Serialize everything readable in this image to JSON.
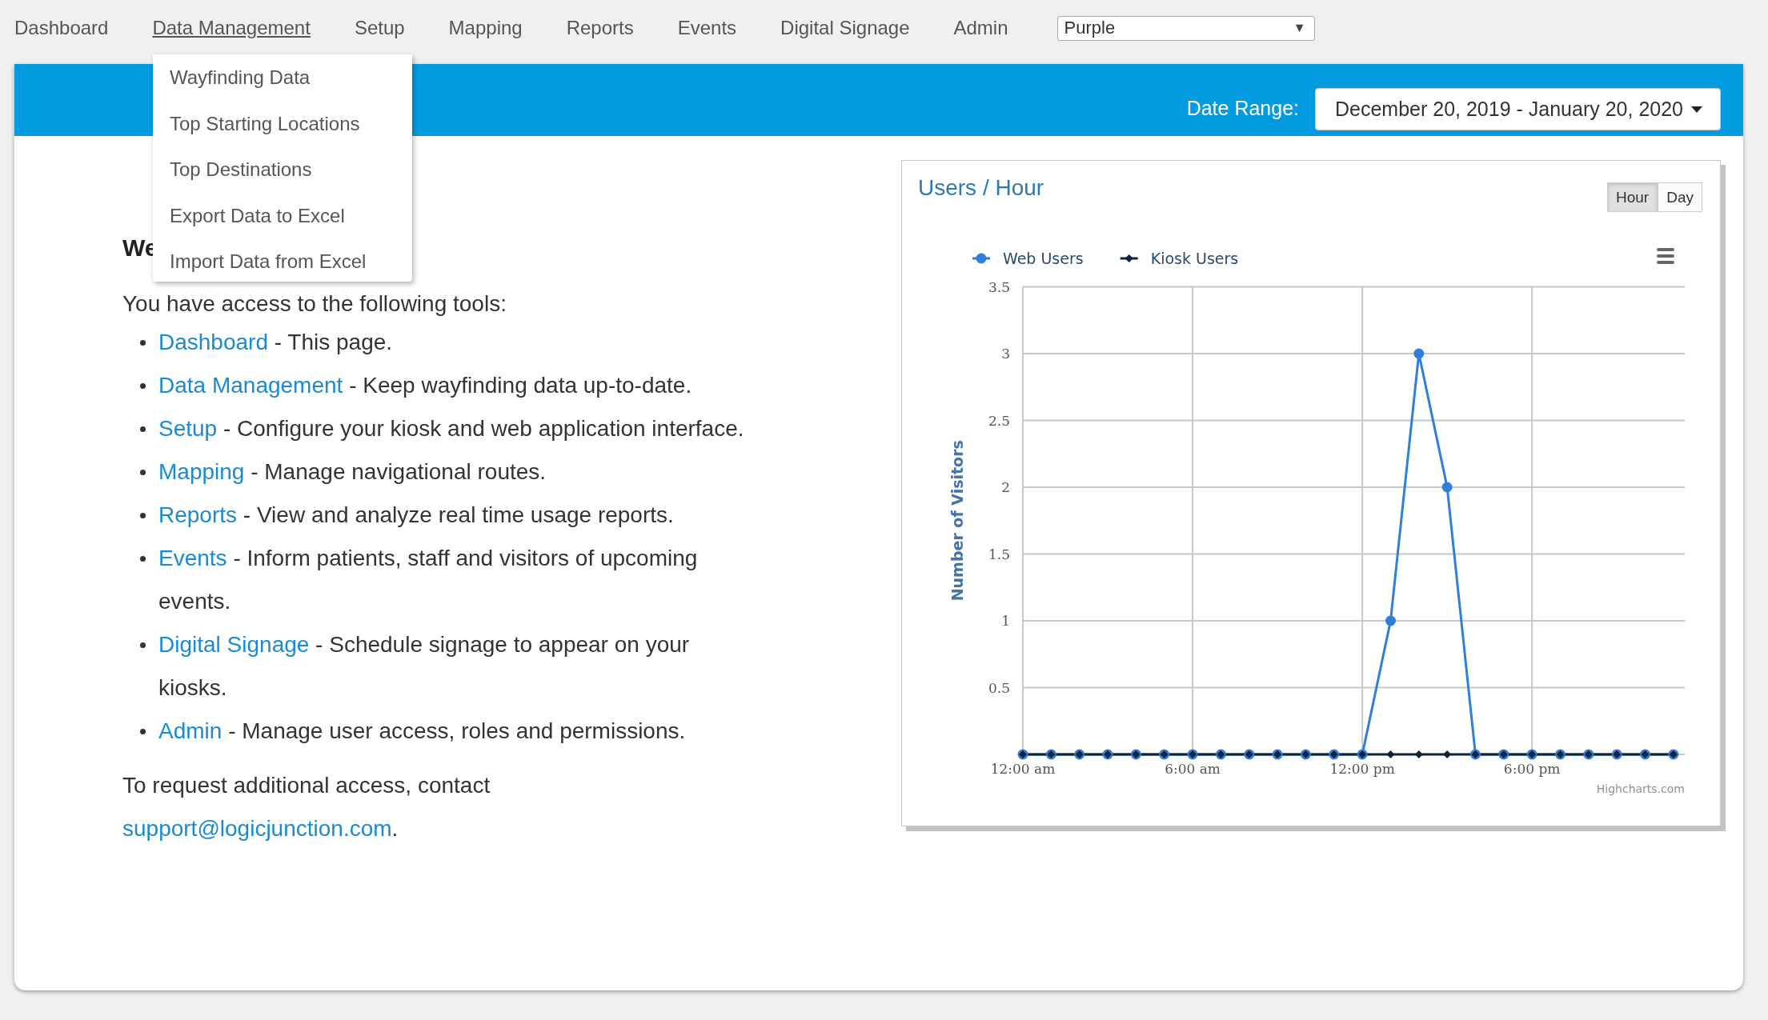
{
  "nav": {
    "items": [
      {
        "label": "Dashboard",
        "selected": false
      },
      {
        "label": "Data Management",
        "selected": true
      },
      {
        "label": "Setup",
        "selected": false
      },
      {
        "label": "Mapping",
        "selected": false
      },
      {
        "label": "Reports",
        "selected": false
      },
      {
        "label": "Events",
        "selected": false
      },
      {
        "label": "Digital Signage",
        "selected": false
      },
      {
        "label": "Admin",
        "selected": false
      }
    ],
    "theme_select": {
      "value": "Purple",
      "caret": "▼"
    }
  },
  "dropdown_menu": {
    "items": [
      "Wayfinding Data",
      "Top Starting Locations",
      "Top Destinations",
      "Export Data to Excel",
      "Import Data from Excel"
    ]
  },
  "header_bar": {
    "date_range_label": "Date Range:",
    "date_range": "December 20, 2019 - January 20, 2020"
  },
  "welcome": {
    "heading": "We",
    "intro": "You have access to the following tools:",
    "tools": [
      {
        "link": "Dashboard",
        "description": " - This page."
      },
      {
        "link": "Data Management",
        "description": " - Keep wayfinding data up-to-date."
      },
      {
        "link": "Setup",
        "description": " - Configure your kiosk and web application interface."
      },
      {
        "link": "Mapping",
        "description": " - Manage navigational routes."
      },
      {
        "link": "Reports",
        "description": " - View and analyze real time usage reports."
      },
      {
        "link": "Events",
        "description": " - Inform patients, staff and visitors of upcoming events."
      },
      {
        "link": "Digital Signage",
        "description": " - Schedule signage to appear on your kiosks."
      },
      {
        "link": "Admin",
        "description": " - Manage user access, roles and permissions."
      }
    ],
    "contact_text": "To request additional access, contact",
    "contact_email": "support@logicjunction.com",
    "contact_suffix": "."
  },
  "chart_card": {
    "title": "Users / Hour",
    "toggle": [
      {
        "label": "Hour",
        "selected": true
      },
      {
        "label": "Day",
        "selected": false
      }
    ],
    "credits": "Highcharts.com",
    "chart_data": {
      "type": "line",
      "ylabel": "Number of Visitors",
      "grid": true,
      "legend": true,
      "x": [
        0,
        1,
        2,
        3,
        4,
        5,
        6,
        7,
        8,
        9,
        10,
        11,
        12,
        13,
        14,
        15,
        16,
        17,
        18,
        19,
        20,
        21,
        22,
        23
      ],
      "series": [
        {
          "name": "Web Users",
          "color": "#2f7ed8",
          "marker": "circle",
          "values": [
            0,
            0,
            0,
            0,
            0,
            0,
            0,
            0,
            0,
            0,
            0,
            0,
            0,
            1,
            3,
            2,
            0,
            0,
            0,
            0,
            0,
            0,
            0,
            0
          ]
        },
        {
          "name": "Kiosk Users",
          "color": "#0d233a",
          "marker": "diamond",
          "values": [
            0,
            0,
            0,
            0,
            0,
            0,
            0,
            0,
            0,
            0,
            0,
            0,
            0,
            0,
            0,
            0,
            0,
            0,
            0,
            0,
            0,
            0,
            0,
            0
          ]
        }
      ],
      "xlim": [
        0,
        23.4
      ],
      "ylim": [
        0,
        3.5
      ],
      "xticks": [
        {
          "value": 0,
          "label": "12:00 am"
        },
        {
          "value": 6,
          "label": "6:00 am"
        },
        {
          "value": 12,
          "label": "12:00 pm"
        },
        {
          "value": 18,
          "label": "6:00 pm"
        }
      ],
      "yticks": [
        0.5,
        1,
        1.5,
        2,
        2.5,
        3,
        3.5
      ]
    }
  }
}
